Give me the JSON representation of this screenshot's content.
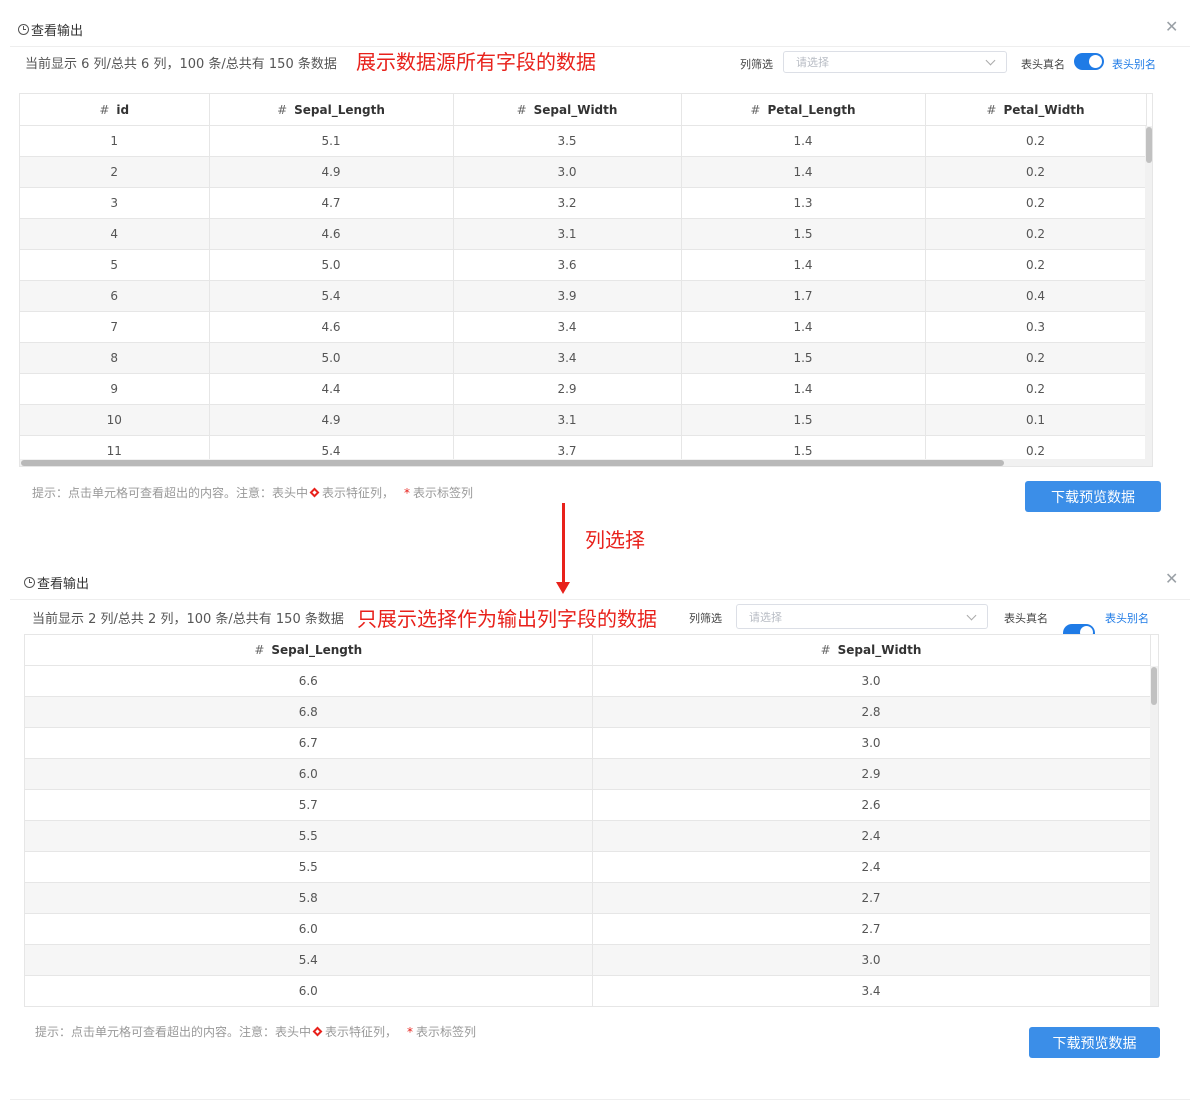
{
  "colors": {
    "annotation_red": "#e8211b",
    "primary_blue": "#3b8ee8",
    "switch_blue": "#1f7be6"
  },
  "top": {
    "title": "查看输出",
    "info": "当前显示 6 列/总共 6 列，100 条/总共有 150 条数据",
    "annotation": "展示数据源所有字段的数据",
    "filter_label": "列筛选",
    "filter_placeholder": "请选择",
    "switch_label_real": "表头真名",
    "switch_label_alias": "表头别名",
    "columns": [
      "id",
      "Sepal_Length",
      "Sepal_Width",
      "Petal_Length",
      "Petal_Width"
    ],
    "rows": [
      [
        "1",
        "5.1",
        "3.5",
        "1.4",
        "0.2"
      ],
      [
        "2",
        "4.9",
        "3.0",
        "1.4",
        "0.2"
      ],
      [
        "3",
        "4.7",
        "3.2",
        "1.3",
        "0.2"
      ],
      [
        "4",
        "4.6",
        "3.1",
        "1.5",
        "0.2"
      ],
      [
        "5",
        "5.0",
        "3.6",
        "1.4",
        "0.2"
      ],
      [
        "6",
        "5.4",
        "3.9",
        "1.7",
        "0.4"
      ],
      [
        "7",
        "4.6",
        "3.4",
        "1.4",
        "0.3"
      ],
      [
        "8",
        "5.0",
        "3.4",
        "1.5",
        "0.2"
      ],
      [
        "9",
        "4.4",
        "2.9",
        "1.4",
        "0.2"
      ],
      [
        "10",
        "4.9",
        "3.1",
        "1.5",
        "0.1"
      ],
      [
        "11",
        "5.4",
        "3.7",
        "1.5",
        "0.2"
      ]
    ],
    "hint_prefix": "提示：点击单元格可查看超出的内容。注意：表头中",
    "hint_feature": "表示特征列，",
    "hint_star": "*",
    "hint_label": "表示标签列",
    "download_label": "下载预览数据"
  },
  "middle": {
    "label": "列选择"
  },
  "bottom": {
    "title": "查看输出",
    "info": "当前显示 2 列/总共 2 列，100 条/总共有 150 条数据",
    "annotation": "只展示选择作为输出列字段的数据",
    "filter_label": "列筛选",
    "filter_placeholder": "请选择",
    "switch_label_real": "表头真名",
    "switch_label_alias": "表头别名",
    "columns": [
      "Sepal_Length",
      "Sepal_Width"
    ],
    "rows": [
      [
        "6.6",
        "3.0"
      ],
      [
        "6.8",
        "2.8"
      ],
      [
        "6.7",
        "3.0"
      ],
      [
        "6.0",
        "2.9"
      ],
      [
        "5.7",
        "2.6"
      ],
      [
        "5.5",
        "2.4"
      ],
      [
        "5.5",
        "2.4"
      ],
      [
        "5.8",
        "2.7"
      ],
      [
        "6.0",
        "2.7"
      ],
      [
        "5.4",
        "3.0"
      ],
      [
        "6.0",
        "3.4"
      ]
    ],
    "hint_prefix": "提示：点击单元格可查看超出的内容。注意：表头中",
    "hint_feature": "表示特征列，",
    "hint_star": "*",
    "hint_label": "表示标签列",
    "download_label": "下载预览数据"
  }
}
